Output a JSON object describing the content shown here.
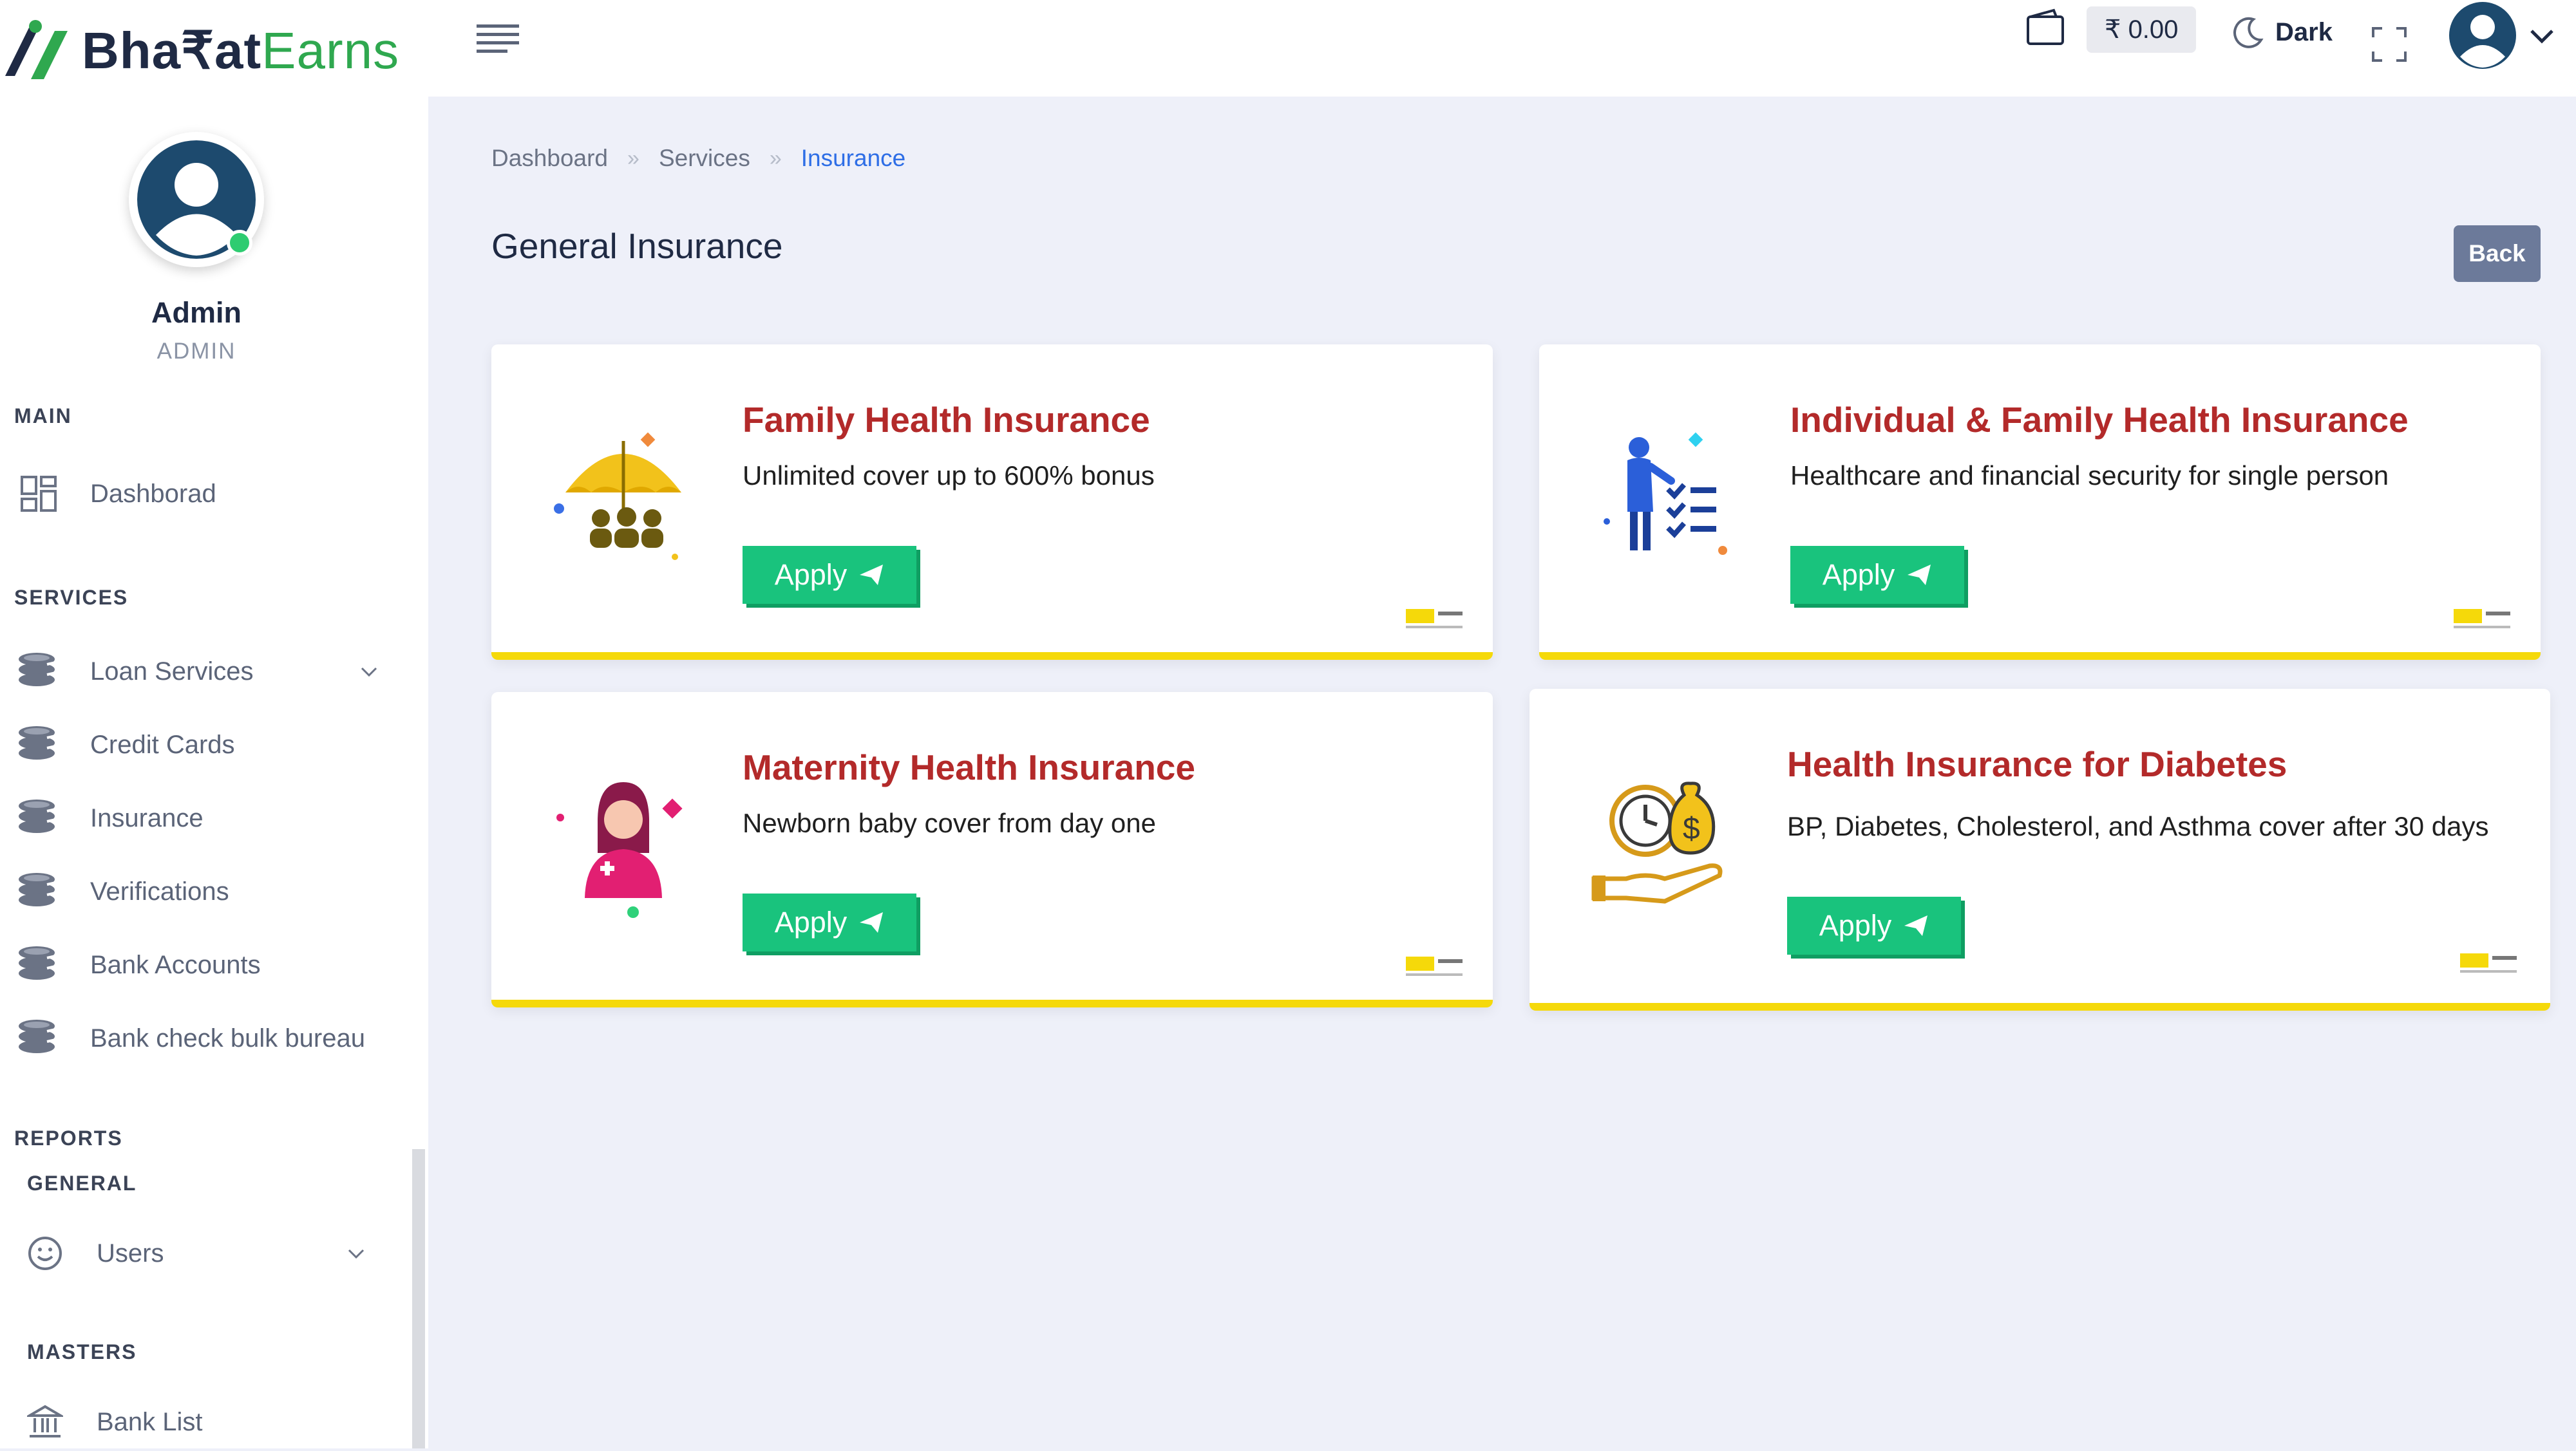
{
  "brand": {
    "part1": "Bha₹at",
    "part2": "Earns"
  },
  "user": {
    "name": "Admin",
    "role": "ADMIN"
  },
  "sidebar": {
    "main_title": "MAIN",
    "dashboard_label": "Dashborad",
    "services_title": "SERVICES",
    "services": [
      {
        "label": "Loan Services"
      },
      {
        "label": "Credit Cards"
      },
      {
        "label": "Insurance"
      },
      {
        "label": "Verifications"
      },
      {
        "label": "Bank Accounts"
      },
      {
        "label": "Bank check bulk bureau"
      }
    ],
    "reports_title": "REPORTS",
    "general_title": "GENERAL",
    "users_label": "Users",
    "masters_title": "MASTERS",
    "bank_list_label": "Bank List"
  },
  "topbar": {
    "balance": "₹ 0.00",
    "dark_label": "Dark"
  },
  "breadcrumb": {
    "items": [
      "Dashboard",
      "Services",
      "Insurance"
    ],
    "separator": "»"
  },
  "page": {
    "title": "General Insurance",
    "back_label": "Back"
  },
  "cards": [
    {
      "title": "Family Health Insurance",
      "desc": "Unlimited cover up to 600% bonus",
      "apply_label": "Apply"
    },
    {
      "title": "Individual & Family Health Insurance",
      "desc": "Healthcare and financial security for single person",
      "apply_label": "Apply"
    },
    {
      "title": "Maternity Health Insurance",
      "desc": "Newborn baby cover from day one",
      "apply_label": "Apply"
    },
    {
      "title": "Health Insurance for Diabetes",
      "desc": "BP, Diabetes, Cholesterol, and Asthma cover after 30 days",
      "apply_label": "Apply"
    }
  ],
  "colors": {
    "accent": "#2e6ee6",
    "apply": "#19c37d",
    "card_title": "#b32a2a",
    "card_border": "#f5d90a",
    "back_button": "#6c7a9a"
  }
}
